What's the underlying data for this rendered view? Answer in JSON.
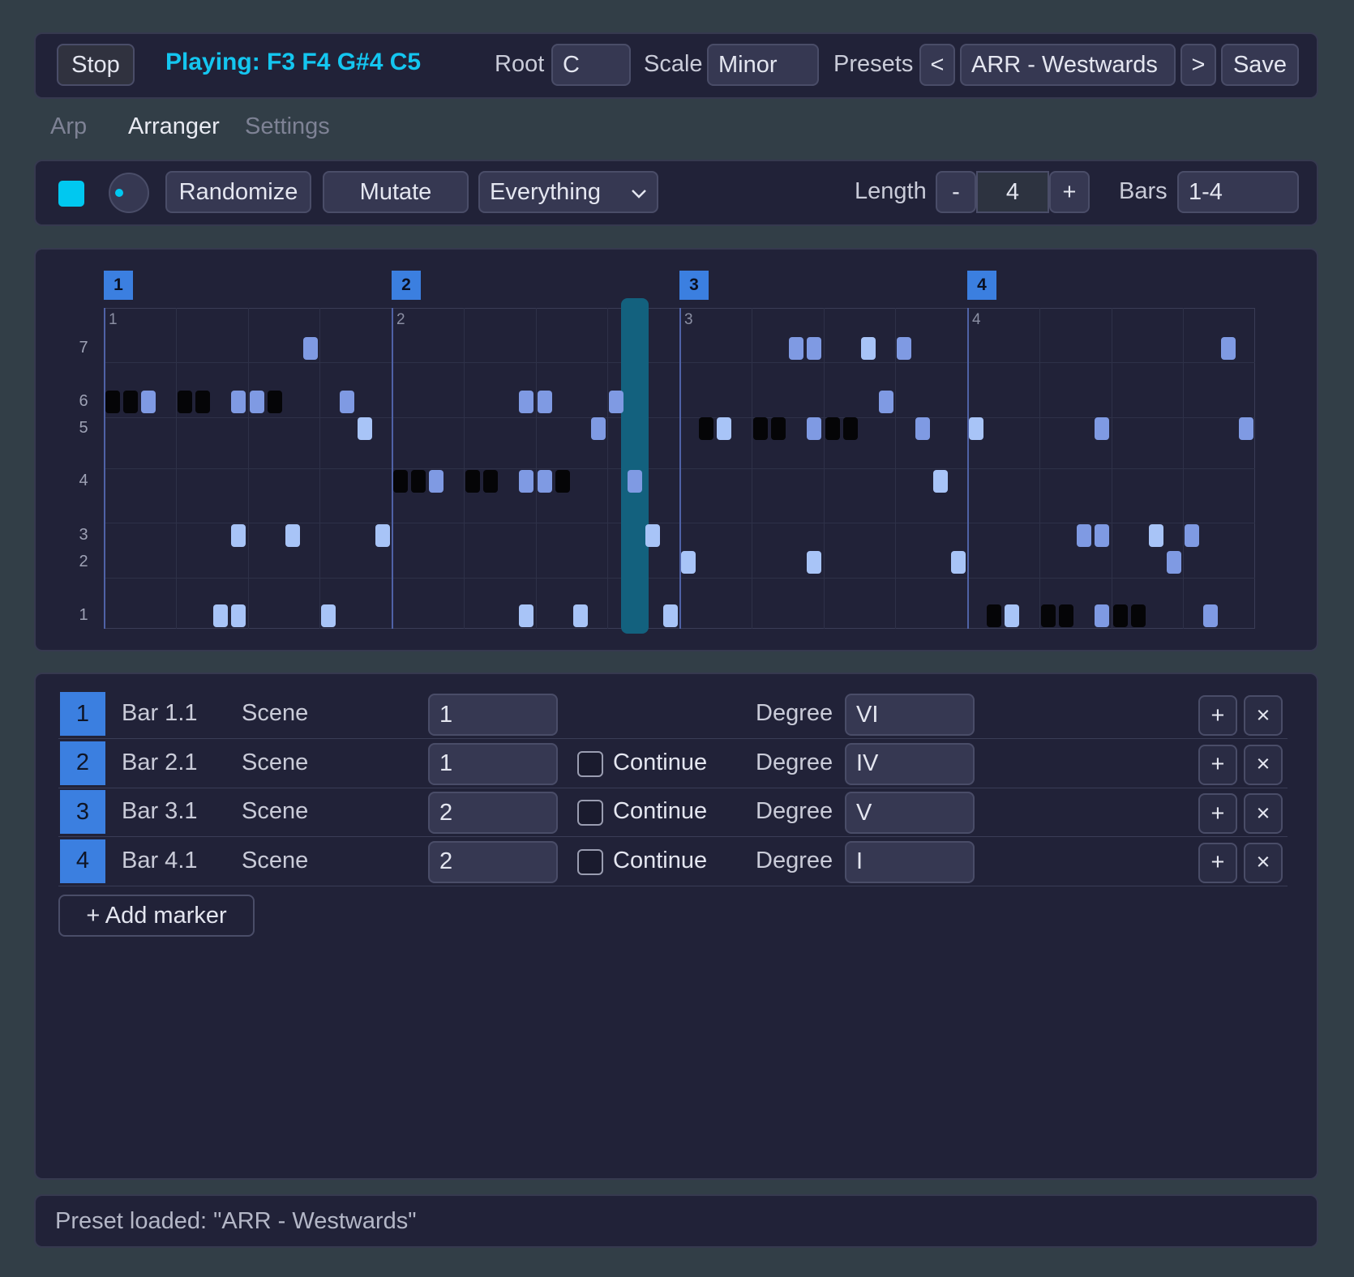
{
  "topbar": {
    "stop_label": "Stop",
    "playing_text": "Playing: F3 F4 G#4 C5",
    "root_label": "Root",
    "root_value": "C",
    "scale_label": "Scale",
    "scale_value": "Minor",
    "presets_label": "Presets",
    "prev_label": "<",
    "preset_value": "ARR - Westwards",
    "next_label": ">",
    "save_label": "Save"
  },
  "tabs": [
    {
      "label": "Arp",
      "active": false
    },
    {
      "label": "Arranger",
      "active": true
    },
    {
      "label": "Settings",
      "active": false
    }
  ],
  "toolbar": {
    "randomize_label": "Randomize",
    "mutate_label": "Mutate",
    "mode_value": "Everything",
    "length_label": "Length",
    "length_minus": "-",
    "length_value": "4",
    "length_plus": "+",
    "bars_label": "Bars",
    "bars_value": "1-4",
    "accent_color": "#00c8f0"
  },
  "arranger": {
    "markers": [
      "1",
      "2",
      "3",
      "4"
    ],
    "bar_numbers": [
      "1",
      "2",
      "3",
      "4"
    ],
    "degree_labels": [
      "7",
      "6",
      "5",
      "4",
      "3",
      "2",
      "1"
    ],
    "playhead_step": 29.5,
    "notes": [
      {
        "step": 0,
        "degree": 6,
        "style": "dark"
      },
      {
        "step": 1,
        "degree": 6,
        "style": "dark"
      },
      {
        "step": 2,
        "degree": 6,
        "style": "mid"
      },
      {
        "step": 4,
        "degree": 6,
        "style": "dark"
      },
      {
        "step": 5,
        "degree": 6,
        "style": "dark"
      },
      {
        "step": 7,
        "degree": 6,
        "style": "mid"
      },
      {
        "step": 8,
        "degree": 6,
        "style": "mid"
      },
      {
        "step": 9,
        "degree": 6,
        "style": "dark"
      },
      {
        "step": 11,
        "degree": 7,
        "style": "mid"
      },
      {
        "step": 13,
        "degree": 6,
        "style": "mid"
      },
      {
        "step": 14,
        "degree": 5,
        "style": "light"
      },
      {
        "step": 7,
        "degree": 3,
        "style": "light"
      },
      {
        "step": 10,
        "degree": 3,
        "style": "light"
      },
      {
        "step": 15,
        "degree": 3,
        "style": "light"
      },
      {
        "step": 6,
        "degree": 1,
        "style": "light"
      },
      {
        "step": 7,
        "degree": 1,
        "style": "light"
      },
      {
        "step": 12,
        "degree": 1,
        "style": "light"
      },
      {
        "step": 16,
        "degree": 4,
        "style": "dark"
      },
      {
        "step": 17,
        "degree": 4,
        "style": "dark"
      },
      {
        "step": 18,
        "degree": 4,
        "style": "mid"
      },
      {
        "step": 20,
        "degree": 4,
        "style": "dark"
      },
      {
        "step": 21,
        "degree": 4,
        "style": "dark"
      },
      {
        "step": 23,
        "degree": 4,
        "style": "mid"
      },
      {
        "step": 24,
        "degree": 4,
        "style": "mid"
      },
      {
        "step": 25,
        "degree": 4,
        "style": "dark"
      },
      {
        "step": 23,
        "degree": 6,
        "style": "mid"
      },
      {
        "step": 24,
        "degree": 6,
        "style": "mid"
      },
      {
        "step": 27,
        "degree": 5,
        "style": "mid"
      },
      {
        "step": 28,
        "degree": 6,
        "style": "mid"
      },
      {
        "step": 29,
        "degree": 4,
        "style": "mid"
      },
      {
        "step": 30,
        "degree": 3,
        "style": "light"
      },
      {
        "step": 23,
        "degree": 1,
        "style": "light"
      },
      {
        "step": 26,
        "degree": 1,
        "style": "light"
      },
      {
        "step": 31,
        "degree": 1,
        "style": "light"
      },
      {
        "step": 32,
        "degree": 2,
        "style": "light"
      },
      {
        "step": 33,
        "degree": 5,
        "style": "dark"
      },
      {
        "step": 34,
        "degree": 5,
        "style": "light"
      },
      {
        "step": 36,
        "degree": 5,
        "style": "dark"
      },
      {
        "step": 37,
        "degree": 5,
        "style": "dark"
      },
      {
        "step": 39,
        "degree": 5,
        "style": "mid"
      },
      {
        "step": 40,
        "degree": 5,
        "style": "dark"
      },
      {
        "step": 41,
        "degree": 5,
        "style": "dark"
      },
      {
        "step": 38,
        "degree": 7,
        "style": "mid"
      },
      {
        "step": 39,
        "degree": 7,
        "style": "mid"
      },
      {
        "step": 42,
        "degree": 7,
        "style": "light"
      },
      {
        "step": 44,
        "degree": 7,
        "style": "mid"
      },
      {
        "step": 43,
        "degree": 6,
        "style": "mid"
      },
      {
        "step": 45,
        "degree": 5,
        "style": "mid"
      },
      {
        "step": 46,
        "degree": 4,
        "style": "light"
      },
      {
        "step": 39,
        "degree": 2,
        "style": "light"
      },
      {
        "step": 47,
        "degree": 2,
        "style": "light"
      },
      {
        "step": 48,
        "degree": 5,
        "style": "light"
      },
      {
        "step": 55,
        "degree": 5,
        "style": "mid"
      },
      {
        "step": 63,
        "degree": 5,
        "style": "mid"
      },
      {
        "step": 62,
        "degree": 7,
        "style": "mid"
      },
      {
        "step": 54,
        "degree": 3,
        "style": "mid"
      },
      {
        "step": 55,
        "degree": 3,
        "style": "mid"
      },
      {
        "step": 58,
        "degree": 3,
        "style": "light"
      },
      {
        "step": 60,
        "degree": 3,
        "style": "mid"
      },
      {
        "step": 59,
        "degree": 2,
        "style": "mid"
      },
      {
        "step": 49,
        "degree": 1,
        "style": "dark"
      },
      {
        "step": 50,
        "degree": 1,
        "style": "light"
      },
      {
        "step": 52,
        "degree": 1,
        "style": "dark"
      },
      {
        "step": 53,
        "degree": 1,
        "style": "dark"
      },
      {
        "step": 55,
        "degree": 1,
        "style": "mid"
      },
      {
        "step": 56,
        "degree": 1,
        "style": "dark"
      },
      {
        "step": 57,
        "degree": 1,
        "style": "dark"
      },
      {
        "step": 61,
        "degree": 1,
        "style": "mid"
      }
    ]
  },
  "markers_table": {
    "scene_label": "Scene",
    "continue_label": "Continue",
    "degree_label": "Degree",
    "add_label": "+",
    "remove_label": "×",
    "add_marker_label": "+ Add marker",
    "rows": [
      {
        "index": "1",
        "bar": "Bar 1.1",
        "scene": "1",
        "continue": null,
        "degree": "VI"
      },
      {
        "index": "2",
        "bar": "Bar 2.1",
        "scene": "1",
        "continue": false,
        "degree": "IV"
      },
      {
        "index": "3",
        "bar": "Bar 3.1",
        "scene": "2",
        "continue": false,
        "degree": "V"
      },
      {
        "index": "4",
        "bar": "Bar 4.1",
        "scene": "2",
        "continue": false,
        "degree": "I"
      }
    ]
  },
  "status": {
    "text": "Preset loaded: \"ARR - Westwards\""
  }
}
